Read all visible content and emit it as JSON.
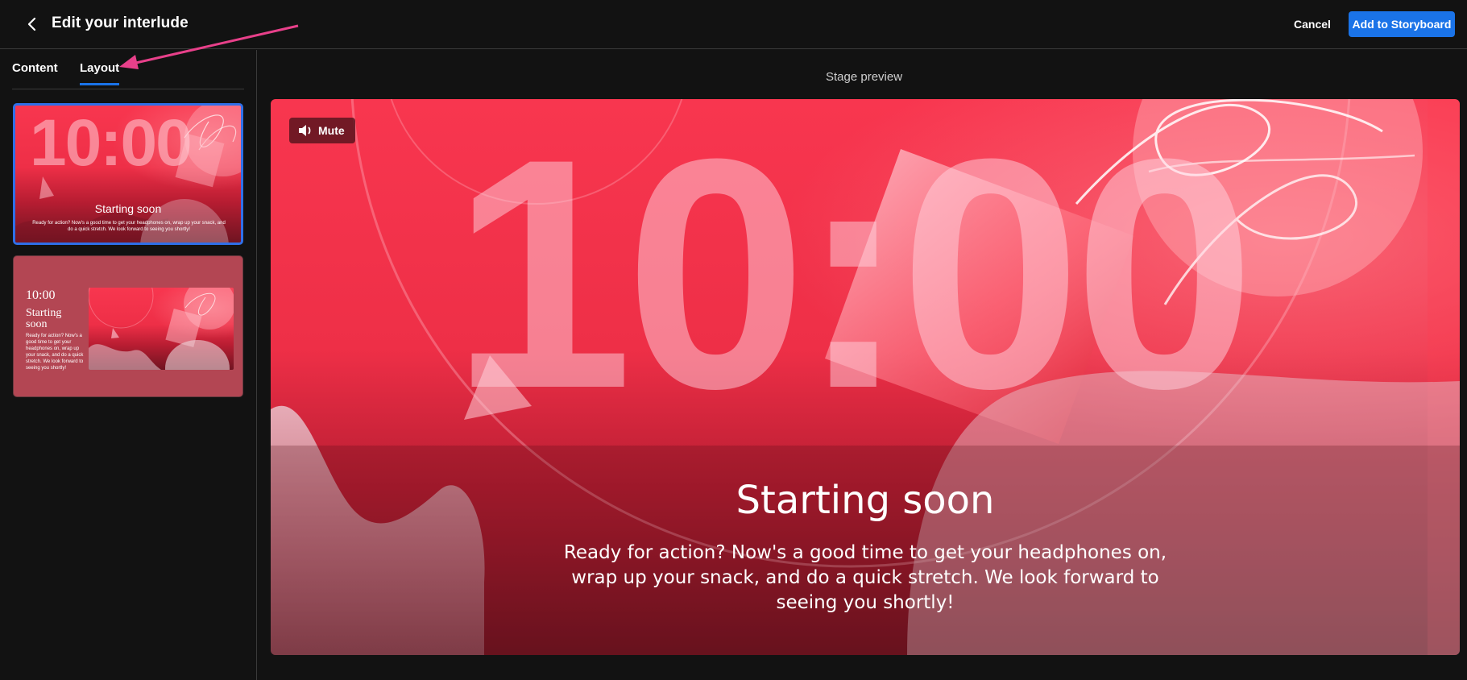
{
  "header": {
    "title": "Edit your interlude",
    "cancel_label": "Cancel",
    "add_label": "Add to Storyboard"
  },
  "sidebar": {
    "tabs": [
      {
        "label": "Content",
        "active": false
      },
      {
        "label": "Layout",
        "active": true
      }
    ],
    "layouts": [
      {
        "selected": true,
        "clock": "10:00",
        "title": "Starting soon",
        "description": "Ready for action? Now's a good time to get your headphones on, wrap up your snack, and do a quick stretch. We look forward to seeing you shortly!"
      },
      {
        "selected": false,
        "clock": "10:00",
        "title": "Starting soon",
        "description": "Ready for action? Now's a good time to get your headphones on, wrap up your snack, and do a quick stretch. We look forward to seeing you shortly!"
      }
    ]
  },
  "stage": {
    "label": "Stage preview",
    "mute_label": "Mute",
    "clock": "10:00",
    "title": "Starting soon",
    "description": "Ready for action? Now's a good time to get your headphones on, wrap up your snack, and do a quick stretch. We look forward to seeing you shortly!"
  },
  "icons": {
    "back": "chevron-left-icon",
    "mute": "speaker-icon"
  },
  "colors": {
    "background": "#121212",
    "accent": "#1a73e8",
    "stage_red": "#f8364f",
    "annotation": "#e8408a"
  }
}
